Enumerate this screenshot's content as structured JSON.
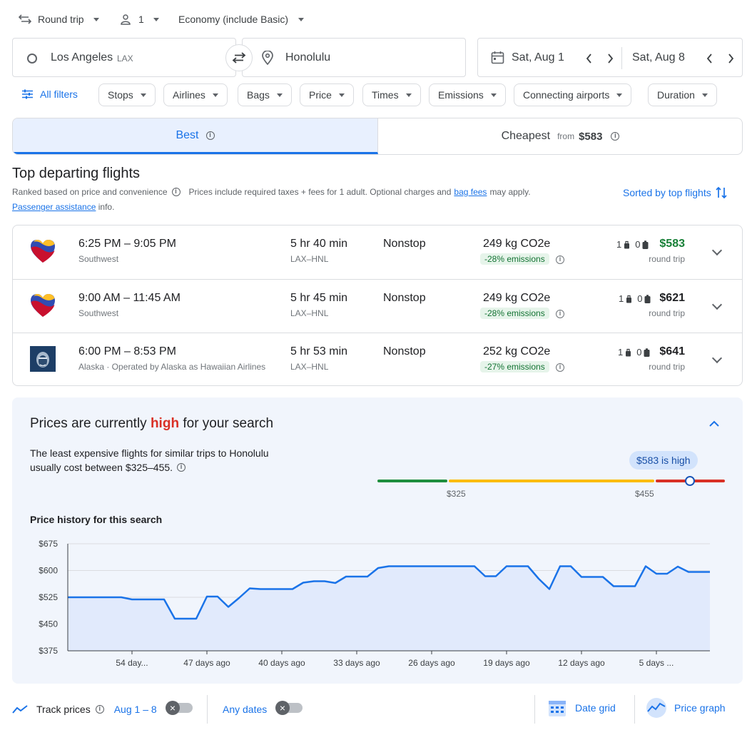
{
  "top_bar": {
    "trip_type": "Round trip",
    "passengers": "1",
    "cabin": "Economy (include Basic)"
  },
  "search": {
    "origin": "Los Angeles",
    "origin_code": "LAX",
    "destination": "Honolulu",
    "depart_date": "Sat, Aug 1",
    "return_date": "Sat, Aug 8"
  },
  "filters": {
    "all_filters": "All filters",
    "chips": [
      "Stops",
      "Airlines",
      "Bags",
      "Price",
      "Times",
      "Emissions",
      "Connecting airports",
      "Duration"
    ]
  },
  "tabs": {
    "best": "Best",
    "cheapest": "Cheapest",
    "cheapest_from": "from",
    "cheapest_price": "$583"
  },
  "results_header": {
    "title": "Top departing flights",
    "ranked": "Ranked based on price and convenience",
    "prices_note": "Prices include required taxes + fees for 1 adult. Optional charges and",
    "bag_fees": "bag fees",
    "may_apply": "may apply.",
    "passenger_assistance": "Passenger assistance",
    "info": "info.",
    "sorted": "Sorted by top flights"
  },
  "flights": [
    {
      "times": "6:25 PM – 9:05 PM",
      "airline": "Southwest",
      "duration": "5 hr 40 min",
      "route": "LAX–HNL",
      "stops": "Nonstop",
      "co2": "249 kg CO2e",
      "emissions": "-28% emissions",
      "carry_on": "1",
      "checked": "0",
      "price": "$583",
      "price_note": "round trip",
      "price_color": "#188038"
    },
    {
      "times": "9:00 AM – 11:45 AM",
      "airline": "Southwest",
      "duration": "5 hr 45 min",
      "route": "LAX–HNL",
      "stops": "Nonstop",
      "co2": "249 kg CO2e",
      "emissions": "-28% emissions",
      "carry_on": "1",
      "checked": "0",
      "price": "$621",
      "price_note": "round trip",
      "price_color": "#202124"
    },
    {
      "times": "6:00 PM – 8:53 PM",
      "airline": "Alaska · Operated by Alaska as Hawaiian Airlines",
      "duration": "5 hr 53 min",
      "route": "LAX–HNL",
      "stops": "Nonstop",
      "co2": "252 kg CO2e",
      "emissions": "-27% emissions",
      "carry_on": "1",
      "checked": "0",
      "price": "$641",
      "price_note": "round trip",
      "price_color": "#202124"
    }
  ],
  "insights": {
    "title_pre": "Prices are currently",
    "title_level": "high",
    "title_post": "for your search",
    "line1": "The least expensive flights for similar trips to Honolulu",
    "line2": "usually cost between $325–455.",
    "bubble": "$583 is high",
    "low_label": "$325",
    "high_label": "$455",
    "history_title": "Price history for this search"
  },
  "chart_data": {
    "type": "area",
    "title": "Price history for this search",
    "ylim": [
      375,
      675
    ],
    "yticks": [
      "$675",
      "$600",
      "$525",
      "$450",
      "$375"
    ],
    "x_tick_labels": [
      "54 day...",
      "47 days ago",
      "40 days ago",
      "33 days ago",
      "26 days ago",
      "19 days ago",
      "12 days ago",
      "5 days ..."
    ],
    "x_tick_days_ago": [
      54,
      47,
      40,
      33,
      26,
      19,
      12,
      5
    ],
    "x_days_ago": [
      60,
      59,
      58,
      57,
      56,
      55,
      54,
      53,
      52,
      51,
      50,
      49,
      48,
      47,
      46,
      45,
      44,
      43,
      42,
      41,
      40,
      39,
      38,
      37,
      36,
      35,
      34,
      33,
      32,
      31,
      30,
      29,
      28,
      27,
      26,
      25,
      24,
      23,
      22,
      21,
      20,
      19,
      18,
      17,
      16,
      15,
      14,
      13,
      12,
      11,
      10,
      9,
      8,
      7,
      6,
      5,
      4,
      3,
      2,
      1,
      0
    ],
    "values": [
      525,
      525,
      525,
      525,
      525,
      525,
      519,
      519,
      519,
      519,
      465,
      465,
      465,
      527,
      527,
      498,
      523,
      550,
      548,
      548,
      548,
      548,
      566,
      570,
      570,
      565,
      583,
      583,
      583,
      607,
      612,
      612,
      612,
      612,
      612,
      612,
      612,
      612,
      612,
      584,
      584,
      612,
      612,
      612,
      577,
      548,
      612,
      612,
      582,
      582,
      582,
      556,
      556,
      556,
      612,
      591,
      591,
      611,
      596,
      596,
      596,
      592,
      592,
      590,
      590
    ],
    "area_color": "#e1eafc",
    "line_color": "#1a73e8"
  },
  "bottom_bar": {
    "track_prices": "Track prices",
    "date_range": "Aug 1 – 8",
    "any_dates": "Any dates",
    "date_grid": "Date grid",
    "price_graph": "Price graph"
  }
}
